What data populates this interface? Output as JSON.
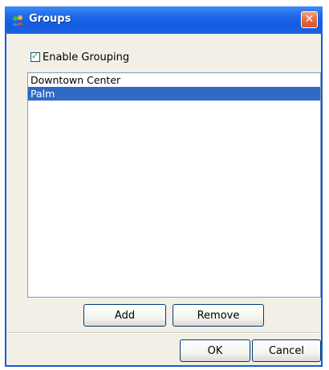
{
  "window": {
    "title": "Groups",
    "title_icon": "groups-icon",
    "close_icon": "close-icon"
  },
  "options": {
    "enable_grouping_label": "Enable Grouping",
    "enable_grouping_checked": true
  },
  "groups_list": {
    "items": [
      {
        "label": "Downtown Center",
        "selected": false
      },
      {
        "label": "Palm",
        "selected": true
      }
    ]
  },
  "list_actions": {
    "add_label": "Add",
    "remove_label": "Remove"
  },
  "dialog_actions": {
    "ok_label": "OK",
    "cancel_label": "Cancel"
  },
  "colors": {
    "titlebar": "#135be0",
    "selection": "#316ac5",
    "close_button": "#e36b3f"
  }
}
